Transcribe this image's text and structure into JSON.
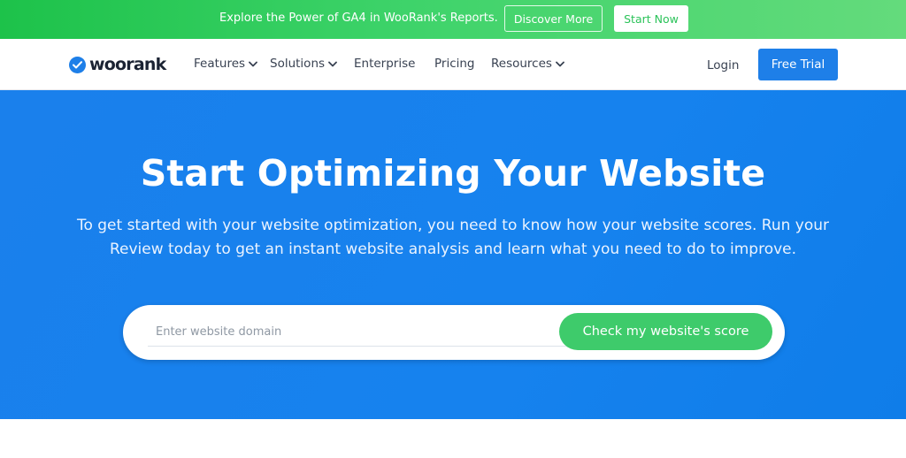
{
  "promo": {
    "text": "Explore the Power of GA4 in WooRank's Reports.",
    "discover_label": "Discover More",
    "start_label": "Start Now"
  },
  "nav": {
    "logo_text": "woorank",
    "items": [
      {
        "label": "Features",
        "has_dropdown": true
      },
      {
        "label": "Solutions",
        "has_dropdown": true
      },
      {
        "label": "Enterprise",
        "has_dropdown": false
      },
      {
        "label": "Pricing",
        "has_dropdown": false
      },
      {
        "label": "Resources",
        "has_dropdown": true
      }
    ],
    "login_label": "Login",
    "free_trial_label": "Free Trial"
  },
  "hero": {
    "title": "Start Optimizing Your Website",
    "subtitle": "To get started with your website optimization, you need to know how your website scores. Run your Review today to get an instant website analysis and learn what you need to do to improve.",
    "search": {
      "placeholder": "Enter website domain",
      "value": ""
    },
    "cta_label": "Check my website's score"
  },
  "colors": {
    "brand_blue": "#1e7fe8",
    "brand_green": "#3ecb6b",
    "banner_green": "#1dc24a"
  },
  "icons": {
    "logo": "check-circle-icon",
    "dropdown": "chevron-down-icon"
  }
}
